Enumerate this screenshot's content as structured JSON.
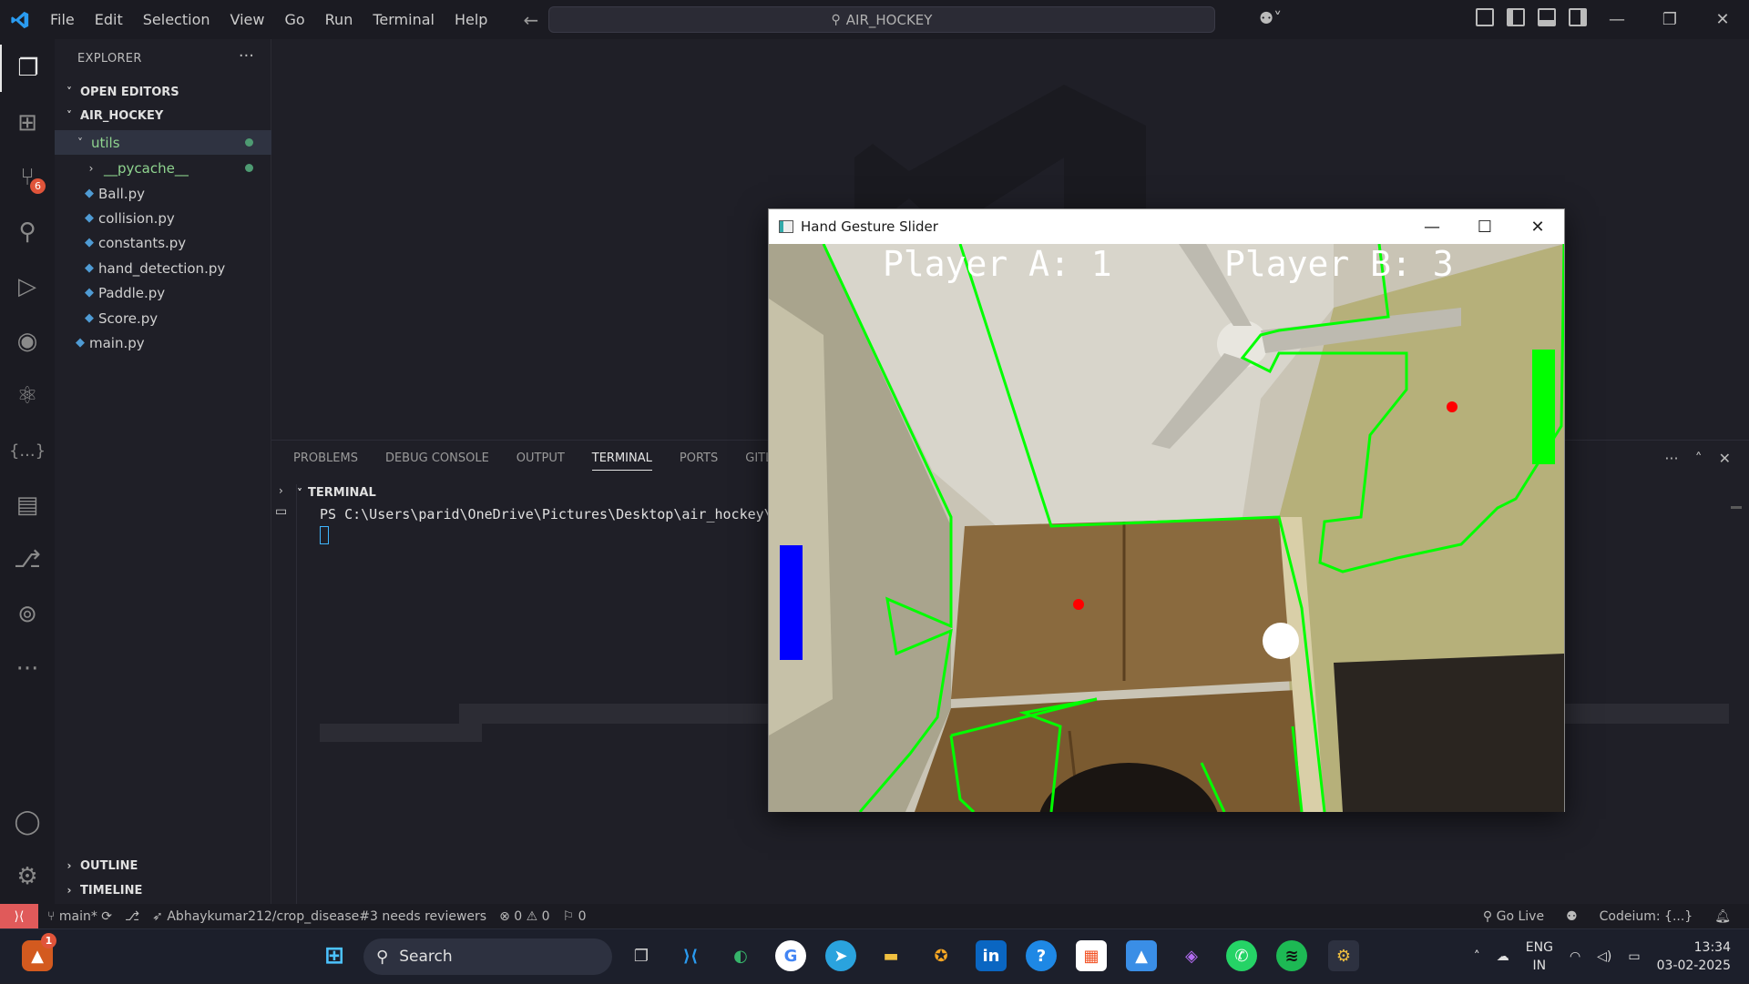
{
  "titlebar": {
    "menu": [
      "File",
      "Edit",
      "Selection",
      "View",
      "Go",
      "Run",
      "Terminal",
      "Help"
    ],
    "search_text": "AIR_HOCKEY"
  },
  "activity": {
    "source_control_badge": "6"
  },
  "sidebar": {
    "title": "EXPLORER",
    "more": "···",
    "open_editors": "OPEN EDITORS",
    "project": "AIR_HOCKEY",
    "folder_utils": "utils",
    "folder_pycache": "__pycache__",
    "files": [
      "Ball.py",
      "collision.py",
      "constants.py",
      "hand_detection.py",
      "Paddle.py",
      "Score.py"
    ],
    "main_file": "main.py",
    "outline": "OUTLINE",
    "timeline": "TIMELINE"
  },
  "panel": {
    "tabs": [
      "PROBLEMS",
      "DEBUG CONSOLE",
      "OUTPUT",
      "TERMINAL",
      "PORTS",
      "GITLEN"
    ],
    "active_tab": "TERMINAL",
    "terminal_header": "TERMINAL",
    "prompt": "PS C:\\Users\\parid\\OneDrive\\Pictures\\Desktop\\air_hockey\\"
  },
  "statusbar": {
    "branch": "main*",
    "pr_text": "Abhaykumar212/crop_disease#3 needs reviewers",
    "errors": "0",
    "warnings": "0",
    "ports": "0",
    "go_live": "Go Live",
    "codeium": "Codeium: {...}"
  },
  "appwindow": {
    "title": "Hand Gesture Slider",
    "score_a": "Player A: 1",
    "score_b": "Player B: 3",
    "colors": {
      "outline": "#00ff00",
      "paddle_a": "#0000ff",
      "paddle_b": "#00ff00",
      "puck": "#ffffff",
      "marker": "#ff0000"
    }
  },
  "taskbar": {
    "search_label": "Search",
    "notification_badge": "1",
    "lang_top": "ENG",
    "lang_bottom": "IN",
    "time": "13:34",
    "date": "03-02-2025"
  }
}
